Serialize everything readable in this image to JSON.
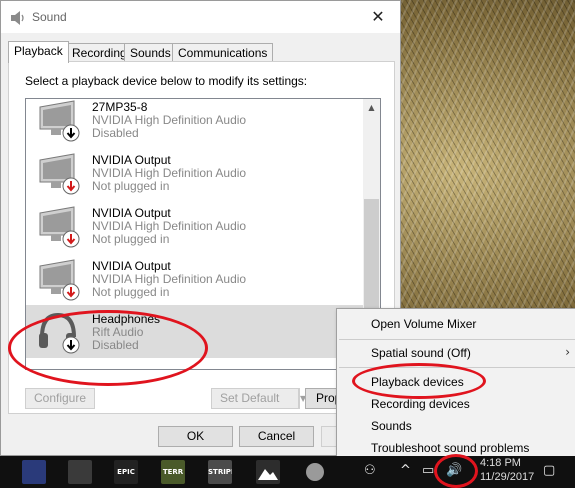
{
  "window": {
    "title": "Sound",
    "close_glyph": "✕"
  },
  "tabs": [
    {
      "label": "Playback",
      "active": true
    },
    {
      "label": "Recording",
      "active": false
    },
    {
      "label": "Sounds",
      "active": false
    },
    {
      "label": "Communications",
      "active": false
    }
  ],
  "playback": {
    "instruction": "Select a playback device below to modify its settings:",
    "devices": [
      {
        "name": "27MP35-8",
        "driver": "NVIDIA High Definition Audio",
        "status": "Disabled",
        "icon": "monitor-icon",
        "badge": "down-arrow-black"
      },
      {
        "name": "NVIDIA Output",
        "driver": "NVIDIA High Definition Audio",
        "status": "Not plugged in",
        "icon": "monitor-icon",
        "badge": "down-arrow-red"
      },
      {
        "name": "NVIDIA Output",
        "driver": "NVIDIA High Definition Audio",
        "status": "Not plugged in",
        "icon": "monitor-icon",
        "badge": "down-arrow-red"
      },
      {
        "name": "NVIDIA Output",
        "driver": "NVIDIA High Definition Audio",
        "status": "Not plugged in",
        "icon": "monitor-icon",
        "badge": "down-arrow-red"
      },
      {
        "name": "Headphones",
        "driver": "Rift Audio",
        "status": "Disabled",
        "icon": "headphones-icon",
        "badge": "down-arrow-black",
        "selected": true
      }
    ],
    "buttons": {
      "configure": "Configure",
      "set_default": "Set Default",
      "properties": "Prop"
    }
  },
  "dialog_buttons": {
    "ok": "OK",
    "cancel": "Cancel"
  },
  "context_menu": {
    "items": [
      {
        "label": "Open Volume Mixer"
      },
      {
        "label": "Spatial sound (Off)",
        "submenu": true
      },
      {
        "label": "Playback devices"
      },
      {
        "label": "Recording devices"
      },
      {
        "label": "Sounds"
      },
      {
        "label": "Troubleshoot sound problems"
      }
    ],
    "submenu_glyph": "›"
  },
  "taskbar": {
    "apps": [
      {
        "name": "app-1-icon",
        "label": ""
      },
      {
        "name": "clapperboard-icon",
        "label": ""
      },
      {
        "name": "epic-games-icon",
        "label": "EPIC"
      },
      {
        "name": "app-terraria-icon",
        "label": "TERR"
      },
      {
        "name": "app-stripe-icon",
        "label": "STRIPE"
      },
      {
        "name": "photos-icon",
        "label": ""
      },
      {
        "name": "app-round-icon",
        "label": ""
      }
    ],
    "clock_time": "4:18 PM",
    "clock_date": "11/29/2017"
  },
  "colors": {
    "annotation": "#e0141e",
    "selected_row": "#dcdcdc",
    "menu_bg": "#f2f2f2",
    "taskbar_bg": "#101010"
  }
}
